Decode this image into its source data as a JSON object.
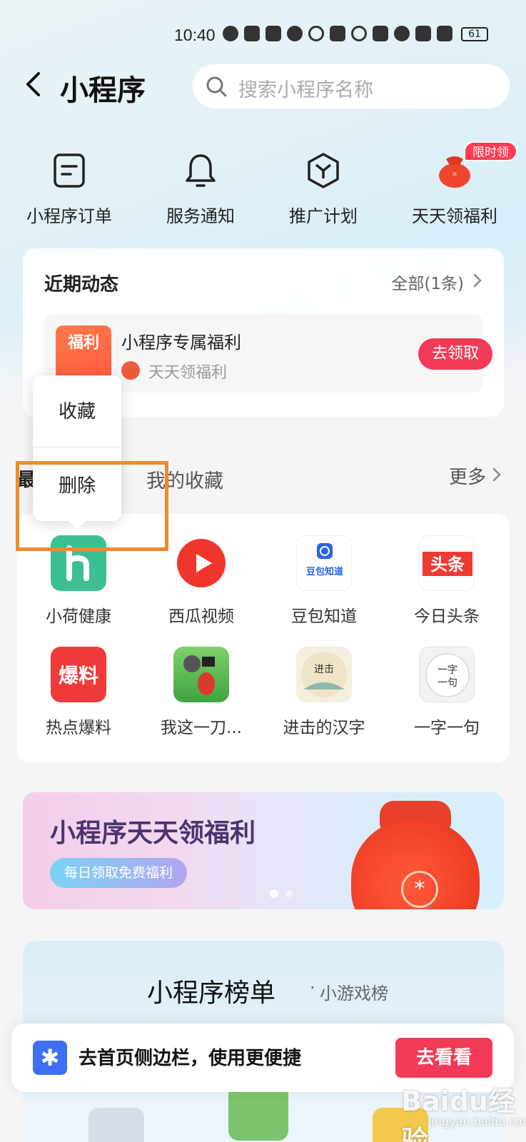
{
  "status_bar": {
    "time": "10:40",
    "battery": "61"
  },
  "header": {
    "title": "小程序",
    "search_placeholder": "搜索小程序名称"
  },
  "quick_actions": [
    {
      "label": "小程序订单",
      "icon": "order-icon"
    },
    {
      "label": "服务通知",
      "icon": "bell-icon"
    },
    {
      "label": "推广计划",
      "icon": "cube-icon"
    },
    {
      "label": "天天领福利",
      "icon": "lucky-bag-icon"
    }
  ],
  "quick_badge": "限时领",
  "recent": {
    "title": "近期动态",
    "all_label": "全部(1条)",
    "item": {
      "thumb_text": "福利",
      "name": "小程序专属福利",
      "source": "天天领福利",
      "button": "去领取"
    }
  },
  "context_menu": {
    "item1": "收藏",
    "item2": "删除"
  },
  "tabs": {
    "tab1": "最近使用",
    "tab2": "我的收藏",
    "more": "更多"
  },
  "apps": [
    {
      "label": "小荷健康",
      "icon": "xiaohe-health-icon"
    },
    {
      "label": "西瓜视频",
      "icon": "xigua-video-icon"
    },
    {
      "label": "豆包知道",
      "icon": "doubao-icon"
    },
    {
      "label": "今日头条",
      "icon": "toutiao-icon"
    },
    {
      "label": "热点爆料",
      "icon": "baoliao-icon"
    },
    {
      "label": "我这一刀...",
      "icon": "game-icon"
    },
    {
      "label": "进击的汉字",
      "icon": "hanzi-game-icon"
    },
    {
      "label": "一字一句",
      "icon": "yiziyiju-icon"
    }
  ],
  "app_icon_text": {
    "toutiao": "头条",
    "baoliao": "爆料",
    "doubao": "豆包知道",
    "yiziyiju": "一字一句"
  },
  "banner": {
    "title": "小程序天天领福利",
    "pill": "每日领取免费福利"
  },
  "ranking": {
    "title": "小程序榜单",
    "sub": "小游戏榜"
  },
  "bottom_bar": {
    "text": "去首页侧边栏，使用更便捷",
    "button": "去看看"
  },
  "watermark": {
    "main": "Baidu经验",
    "sub": "jingyan.baidu.com"
  },
  "colors": {
    "accent_red": "#f23a58",
    "highlight_orange": "#f08a2c",
    "blue": "#3e6ff6"
  }
}
